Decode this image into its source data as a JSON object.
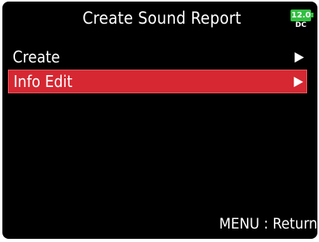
{
  "header": {
    "title": "Create Sound Report"
  },
  "battery": {
    "level": "12.0",
    "source": "DC",
    "color": "#30c040"
  },
  "menu": {
    "items": [
      {
        "label": "Create",
        "arrow": "▶",
        "selected": false
      },
      {
        "label": "Info Edit",
        "arrow": "▶",
        "selected": true
      }
    ],
    "selected_color": "#d52832"
  },
  "footer": {
    "hint": "MENU : Return"
  }
}
